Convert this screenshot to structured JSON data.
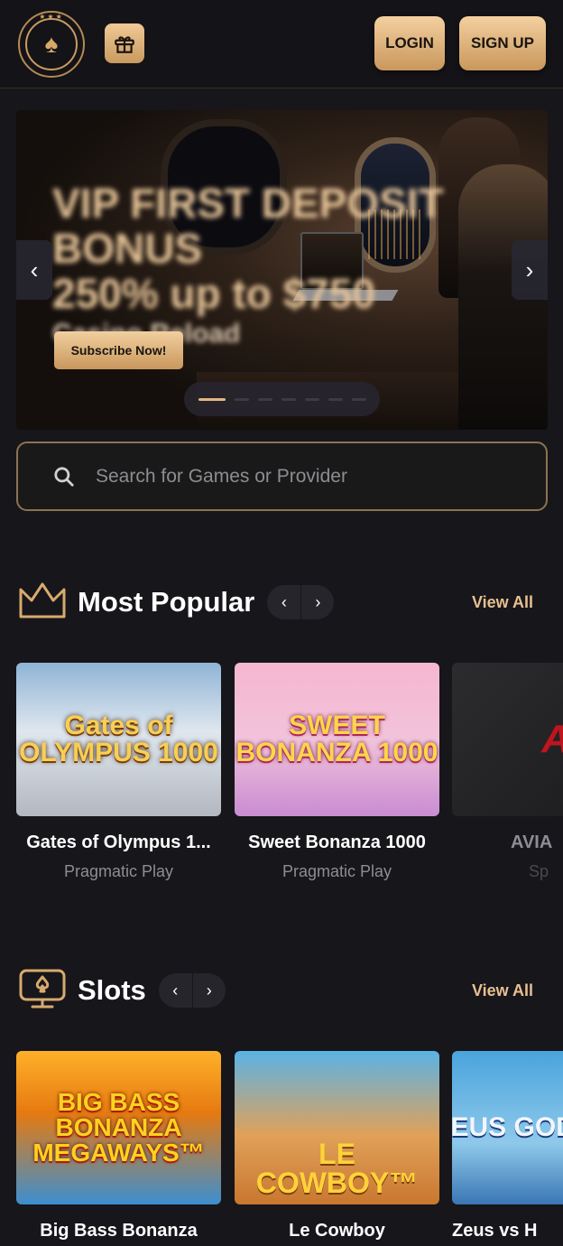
{
  "header": {
    "login_label": "LOGIN",
    "signup_label": "SIGN UP"
  },
  "banner": {
    "promo_line1": "VIP FIRST DEPOSIT BONUS",
    "promo_line2": "250% up to $750",
    "promo_line3": "Casino Reload",
    "cta_label": "Subscribe Now!",
    "slide_count": 8,
    "active_slide": 1
  },
  "search": {
    "placeholder": "Search for Games or Provider"
  },
  "sections": {
    "popular": {
      "title": "Most Popular",
      "view_all": "View All",
      "games": [
        {
          "name": "Gates of Olympus 1...",
          "provider": "Pragmatic Play",
          "art": "Gates of OLYMPUS 1000"
        },
        {
          "name": "Sweet Bonanza 1000",
          "provider": "Pragmatic Play",
          "art": "SWEET BONANZA 1000"
        },
        {
          "name": "AVIA",
          "provider": "Sp",
          "art": "Avi"
        }
      ]
    },
    "slots": {
      "title": "Slots",
      "view_all": "View All",
      "games": [
        {
          "name": "Big Bass Bonanza",
          "art": "BIG BASS BONANZA MEGAWAYS™"
        },
        {
          "name": "Le Cowboy",
          "art": "LE COWBOY™"
        },
        {
          "name": "Zeus vs H",
          "art": "ZEUS GODS"
        }
      ]
    }
  },
  "colors": {
    "background": "#17161a",
    "gold": "#e4b782",
    "text_muted": "#8e8d93"
  }
}
